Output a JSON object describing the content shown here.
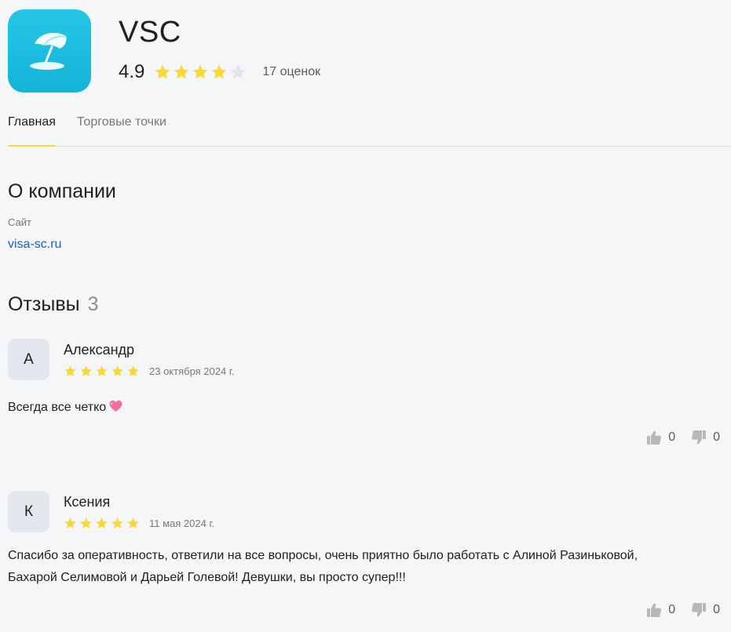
{
  "company": {
    "name": "VSC",
    "rating": "4.9",
    "rating_stars_filled": 4,
    "ratings_count": "17 оценок"
  },
  "tabs": [
    {
      "label": "Главная",
      "active": true
    },
    {
      "label": "Торговые точки",
      "active": false
    }
  ],
  "about": {
    "title": "О компании",
    "site_label": "Сайт",
    "site_url": "visa-sc.ru"
  },
  "reviews": {
    "title": "Отзывы",
    "count": "3",
    "items": [
      {
        "avatar_letter": "А",
        "author": "Александр",
        "stars": 5,
        "date": "23 октября 2024 г.",
        "text": "Всегда все четко",
        "likes": "0",
        "dislikes": "0"
      },
      {
        "avatar_letter": "К",
        "author": "Ксения",
        "stars": 5,
        "date": "11 мая 2024 г.",
        "text": "Спасибо за оперативность, ответили на все вопросы, очень приятно было работать с Алиной Разиньковой, Бахарой Селимовой и Дарьей Голевой! Девушки, вы просто супер!!!",
        "likes": "0",
        "dislikes": "0"
      }
    ]
  },
  "colors": {
    "star_filled": "#fcd836",
    "star_empty": "#e1e4ea",
    "link": "#1a5dce",
    "logo_bg": "#19bde0",
    "tab_underline": "#fcd836"
  }
}
